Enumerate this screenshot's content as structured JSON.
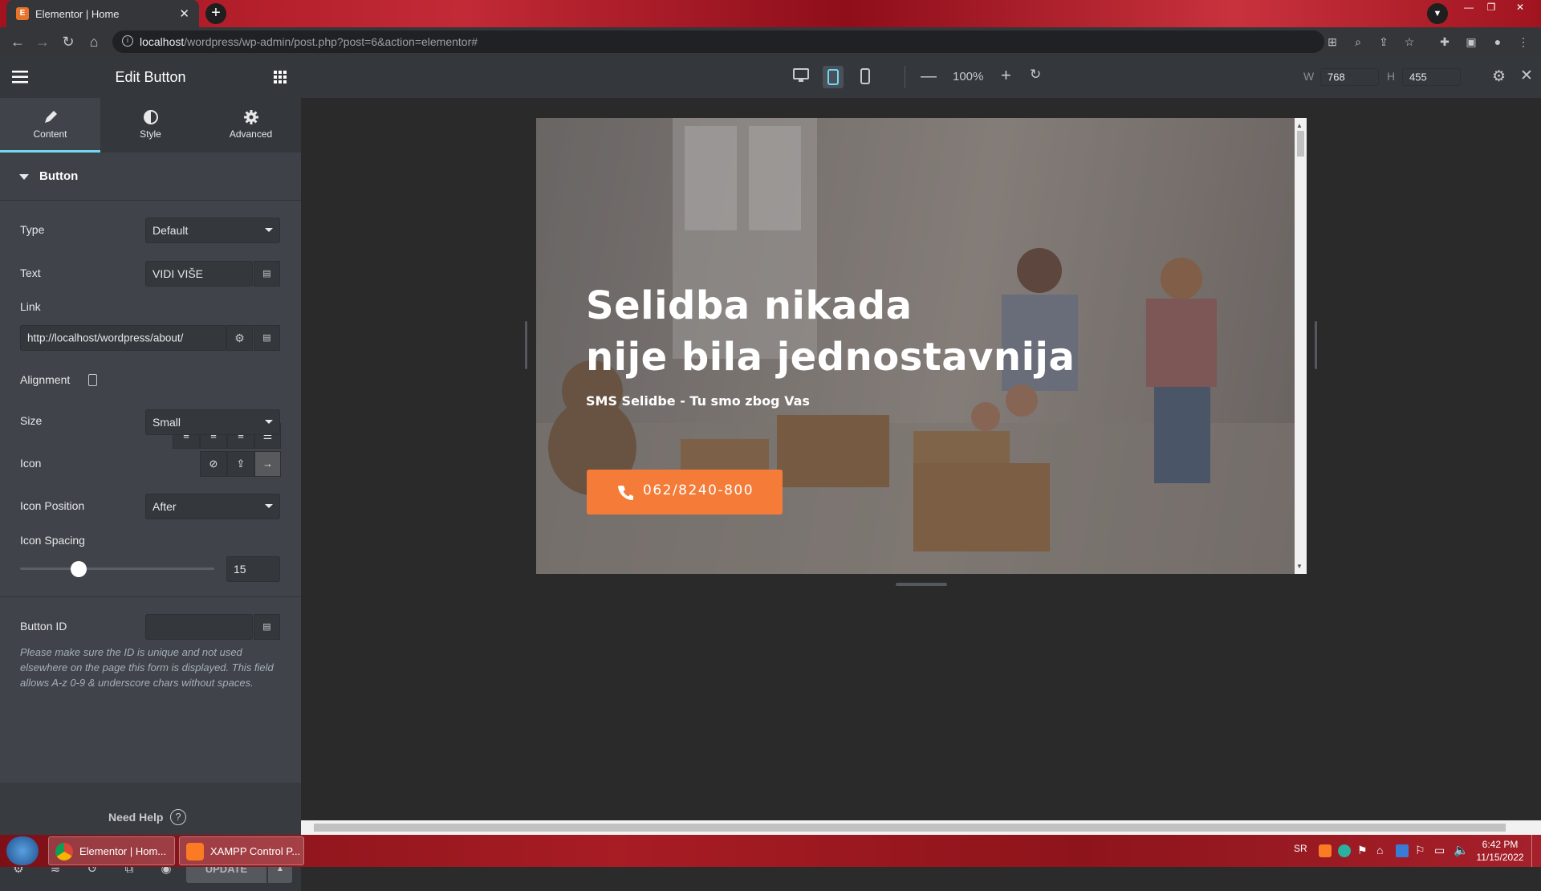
{
  "browser": {
    "tab_title": "Elementor | Home",
    "url_host": "localhost",
    "url_path": "/wordpress/wp-admin/post.php?post=6&action=elementor#"
  },
  "panel": {
    "title": "Edit Button",
    "tabs": [
      {
        "label": "Content",
        "icon": "pencil-icon",
        "active": true
      },
      {
        "label": "Style",
        "icon": "half-circle-icon",
        "active": false
      },
      {
        "label": "Advanced",
        "icon": "gear-icon",
        "active": false
      }
    ],
    "section_title": "Button",
    "fields": {
      "type_label": "Type",
      "type_value": "Default",
      "text_label": "Text",
      "text_value": "VIDI VIŠE",
      "link_label": "Link",
      "link_value": "http://localhost/wordpress/about/",
      "alignment_label": "Alignment",
      "size_label": "Size",
      "size_value": "Small",
      "icon_label": "Icon",
      "icon_position_label": "Icon Position",
      "icon_position_value": "After",
      "icon_spacing_label": "Icon Spacing",
      "icon_spacing_value": "15",
      "icon_spacing_fraction": 0.3,
      "button_id_label": "Button ID",
      "button_id_value": ""
    },
    "note": "Please make sure the ID is unique and not used elsewhere on the page this form is displayed. This field allows A-z 0-9 & underscore chars without spaces.",
    "need_help": "Need Help",
    "update_label": "UPDATE"
  },
  "preview_toolbar": {
    "zoom": "100%",
    "width_label": "W",
    "width_value": "768",
    "height_label": "H",
    "height_value": "455"
  },
  "hero": {
    "title_line1": "Selidba nikada",
    "title_line2": "nije bila jednostavnija",
    "subtitle": "SMS Selidbe - Tu smo zbog Vas",
    "button_text": "062/8240-800",
    "accent_color": "#f47c38"
  },
  "taskbar": {
    "tasks": [
      "Elementor | Hom...",
      "XAMPP Control P..."
    ],
    "lang": "SR",
    "time": "6:42 PM",
    "date": "11/15/2022"
  }
}
